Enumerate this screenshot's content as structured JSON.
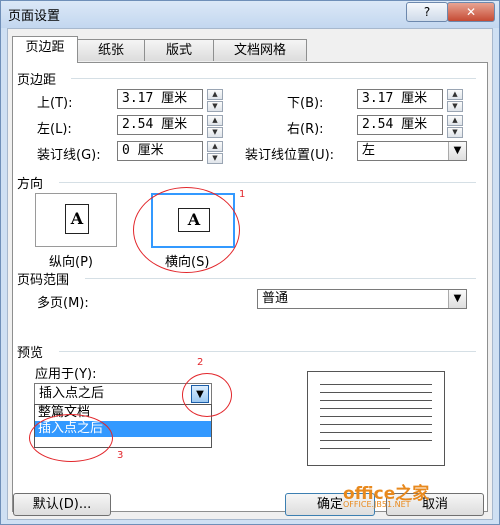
{
  "window": {
    "title": "页面设置",
    "help": "?",
    "close": "✕"
  },
  "tabs": [
    {
      "label": "页边距"
    },
    {
      "label": "纸张"
    },
    {
      "label": "版式"
    },
    {
      "label": "文档网格"
    }
  ],
  "margins": {
    "section_title": "页边距",
    "top_label": "上(T):",
    "top_value": "3.17 厘米",
    "bottom_label": "下(B):",
    "bottom_value": "3.17 厘米",
    "left_label": "左(L):",
    "left_value": "2.54 厘米",
    "right_label": "右(R):",
    "right_value": "2.54 厘米",
    "gutter_label": "装订线(G):",
    "gutter_value": "0 厘米",
    "gutter_pos_label": "装订线位置(U):",
    "gutter_pos_value": "左"
  },
  "orientation": {
    "section_title": "方向",
    "portrait_label": "纵向(P)",
    "landscape_label": "横向(S)",
    "icon_letter": "A",
    "selected": "landscape"
  },
  "pages": {
    "section_title": "页码范围",
    "multi_label": "多页(M):",
    "multi_value": "普通"
  },
  "preview": {
    "section_title": "预览",
    "apply_label": "应用于(Y):",
    "apply_value": "插入点之后",
    "options": [
      "整篇文档",
      "插入点之后"
    ],
    "highlighted_index": 1
  },
  "buttons": {
    "default": "默认(D)...",
    "ok": "确定",
    "cancel": "取消"
  },
  "annotations": {
    "one": "1",
    "two": "2",
    "three": "3"
  },
  "watermark": {
    "text": "office之家",
    "subtext": "OFFICE.JB51.NET"
  },
  "colors": {
    "highlight": "#3399ff",
    "annotation": "#e2262b",
    "watermark": "#e8891d"
  }
}
